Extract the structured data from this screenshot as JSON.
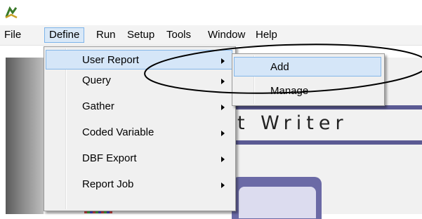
{
  "menubar": {
    "items": [
      {
        "label": "File"
      },
      {
        "label": "Define"
      },
      {
        "label": "Run"
      },
      {
        "label": "Setup"
      },
      {
        "label": "Tools"
      },
      {
        "label": "Window"
      },
      {
        "label": "Help"
      }
    ]
  },
  "define_menu": {
    "items": [
      {
        "label": "User Report",
        "has_submenu": true
      },
      {
        "label": "Query",
        "has_submenu": true
      },
      {
        "label": "Gather",
        "has_submenu": true
      },
      {
        "label": "Coded Variable",
        "has_submenu": true
      },
      {
        "label": "DBF Export",
        "has_submenu": true
      },
      {
        "label": "Report Job",
        "has_submenu": true
      }
    ]
  },
  "user_report_submenu": {
    "items": [
      {
        "label": "Add"
      },
      {
        "label": "Manage"
      }
    ]
  },
  "background": {
    "title_fragment": "t Writer"
  },
  "colors": {
    "menu_bg": "#f0f0f0",
    "highlight_bg": "#d5e6f8",
    "highlight_border": "#84b6e8",
    "band": "#5b5a93"
  }
}
